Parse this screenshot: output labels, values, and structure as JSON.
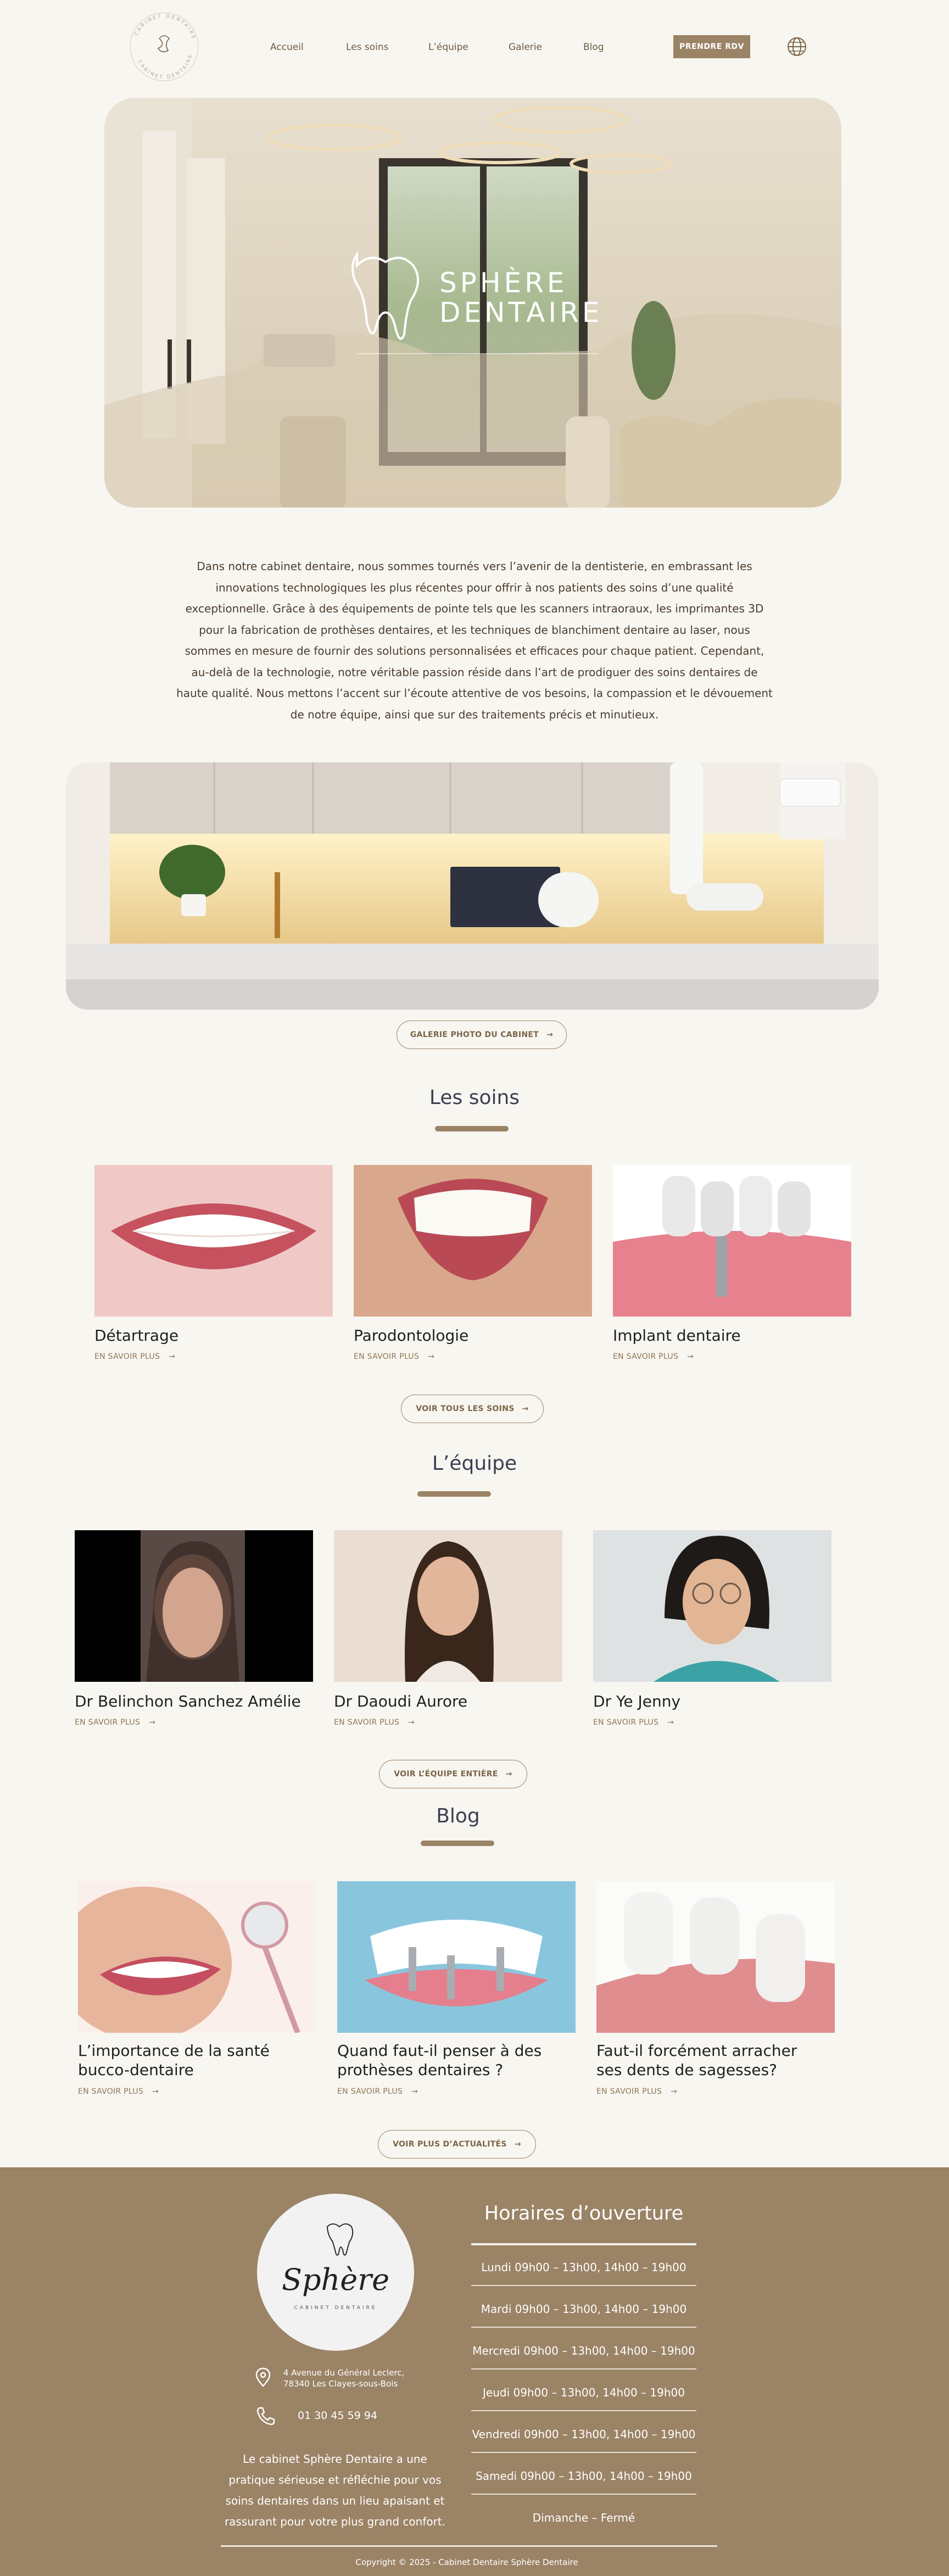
{
  "header": {
    "logo_text_top": "CABINET DENTAIRE",
    "logo_text_bottom": "CABINET DENTAIRE",
    "nav": [
      "Accueil",
      "Les soins",
      "L’équipe",
      "Galerie",
      "Blog"
    ],
    "cta": "PRENDRE RDV",
    "lang_icon": "globe-icon"
  },
  "hero": {
    "title_line1": "SPHÈRE",
    "title_line2": "DENTAIRE"
  },
  "intro": {
    "text": "Dans notre cabinet dentaire, nous sommes tournés vers l’avenir de la dentisterie, en embrassant les innovations technologiques les plus récentes pour offrir à nos patients des soins d’une qualité exceptionnelle. Grâce à des équipements de pointe tels que les scanners intraoraux, les imprimantes 3D pour la fabrication de prothèses dentaires, et les techniques de blanchiment dentaire au laser, nous sommes en mesure de fournir des solutions personnalisées et efficaces pour chaque patient. Cependant, au-delà de la technologie, notre véritable passion réside dans l’art de prodiguer des soins dentaires de haute qualité. Nous mettons l’accent sur l’écoute attentive de vos besoins, la compassion et le dévouement de notre équipe, ainsi que sur des traitements précis et minutieux."
  },
  "gallery_button": "GALERIE PHOTO DU CABINET",
  "soins": {
    "title": "Les soins",
    "items": [
      {
        "title": "Détartrage",
        "more": "EN SAVOIR PLUS"
      },
      {
        "title": "Parodontologie",
        "more": "EN SAVOIR PLUS"
      },
      {
        "title": "Implant dentaire",
        "more": "EN SAVOIR PLUS"
      }
    ],
    "button": "VOIR TOUS LES SOINS"
  },
  "equipe": {
    "title": "L’équipe",
    "items": [
      {
        "title": "Dr Belinchon Sanchez Amélie",
        "more": "EN SAVOIR PLUS"
      },
      {
        "title": "Dr Daoudi Aurore",
        "more": "EN SAVOIR PLUS"
      },
      {
        "title": "Dr Ye Jenny",
        "more": "EN SAVOIR PLUS"
      }
    ],
    "button": "VOIR L’ÉQUIPE ENTIÈRE"
  },
  "blog": {
    "title": "Blog",
    "items": [
      {
        "title_1": "L’importance de la santé",
        "title_2": "bucco-dentaire",
        "more": "EN SAVOIR PLUS"
      },
      {
        "title_1": "Quand faut-il penser à des",
        "title_2": "prothèses dentaires ?",
        "more": "EN SAVOIR PLUS"
      },
      {
        "title_1": "Faut-il forcément arracher",
        "title_2": "ses dents de sagesses?",
        "more": "EN SAVOIR PLUS"
      }
    ],
    "button": "VOIR PLUS D’ACTUALITÉS"
  },
  "footer": {
    "logo_word": "Sphère",
    "logo_sub": "CABINET DENTAIRE",
    "address_1": "4 Avenue du Général Leclerc,",
    "address_2": "78340 Les Clayes-sous-Bois",
    "phone": "01 30 45 59 94",
    "about": [
      "Le cabinet Sphère Dentaire a une",
      "pratique sérieuse et réfléchie pour vos",
      "soins dentaires dans un lieu apaisant et",
      "rassurant pour votre plus grand confort."
    ],
    "hours_title": "Horaires d’ouverture",
    "hours": [
      "Lundi 09h00 – 13h00, 14h00 – 19h00",
      "Mardi  09h00 – 13h00, 14h00 – 19h00",
      "Mercredi  09h00 – 13h00, 14h00 – 19h00",
      "Jeudi  09h00 – 13h00, 14h00 – 19h00",
      "Vendredi  09h00 – 13h00, 14h00 – 19h00",
      "Samedi  09h00 – 13h00, 14h00 – 19h00",
      "Dimanche –  Fermé"
    ],
    "copyright": "Copyright © 2025 - Cabinet Dentaire Sphère Dentaire"
  },
  "colors": {
    "accent": "#9b8366",
    "background": "#f8f6f0",
    "title": "#3a3f52"
  }
}
